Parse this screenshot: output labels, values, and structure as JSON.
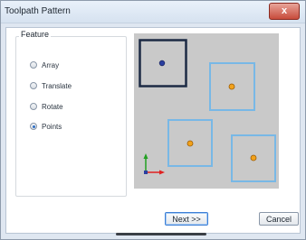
{
  "window": {
    "title": "Toolpath Pattern",
    "close_glyph": "x"
  },
  "feature": {
    "label": "Feature",
    "options": [
      {
        "label": "Array",
        "checked": false
      },
      {
        "label": "Translate",
        "checked": false
      },
      {
        "label": "Rotate",
        "checked": false
      },
      {
        "label": "Points",
        "checked": true
      }
    ]
  },
  "preview": {
    "background": "#c9c9c9",
    "selected_frame_color": "#1c2a44",
    "frame_color": "#78b8e6",
    "point_selected_color": "#2b3fa0",
    "point_color": "#f2a21b",
    "axis_x_color": "#e02020",
    "axis_y_color": "#22a022"
  },
  "buttons": {
    "next_label": "Next >>",
    "cancel_label": "Cancel"
  }
}
